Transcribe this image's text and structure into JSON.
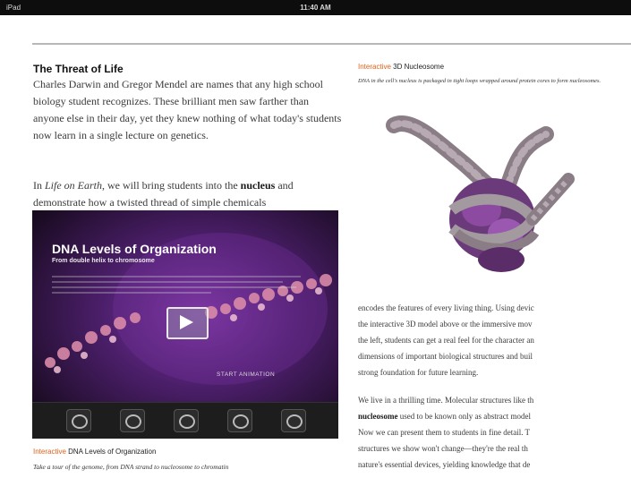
{
  "status_bar": {
    "device": "iPad",
    "time": "11:40 AM"
  },
  "left": {
    "title": "The Threat of Life",
    "para1": "Charles Darwin and Gregor Mendel are names that any high school biology student recognizes. These brilliant men saw farther than anyone else in their day, yet they knew nothing of what today's students now learn in a single lecture on genetics.",
    "para2_before_em": "In ",
    "para2_em": "Life on Earth",
    "para2_middle": ", we will bring students into the ",
    "para2_bold": "nucleus",
    "para2_after": " and demonstrate how a twisted thread of simple chemicals",
    "video": {
      "title": "DNA Levels of Organization",
      "subtitle": "From double helix to chromosome",
      "start_label": "START ANIMATION"
    },
    "caption_tag": "Interactive",
    "caption_text": " DNA Levels of Organization",
    "caption_desc": "Take a tour of the genome, from DNA strand to nucleosome to chromatin"
  },
  "right": {
    "caption_tag": "Interactive",
    "caption_text": " 3D Nucleosome",
    "caption_desc": "DNA in the cell's nucleus is packaged in tight loops wrapped around protein cores to form nucleosomes.",
    "lines_a": [
      "encodes the features of every living thing. Using devic",
      "the interactive 3D model above or the immersive mov",
      "the left, students can get a real feel for the character an",
      "dimensions of important biological structures and buil",
      "strong foundation for future learning."
    ],
    "lines_b_1": "We live in a thrilling time. Molecular structures like th",
    "lines_b_2_bold": "nucleosome",
    "lines_b_2_rest": " used to be known only as abstract model",
    "lines_b_3": "Now we can present them to students in fine detail. T",
    "lines_b_4": "structures we show won't change—they're the real th",
    "lines_b_5": "nature's essential devices, yielding knowledge that de"
  },
  "colors": {
    "accent": "#e2621b",
    "status_bar": "#0d0d0d"
  },
  "icons": [
    "play-icon",
    "chromosome-thumb-icon",
    "nucleosome-thumb-icon",
    "dna-thumb-icon",
    "helix-thumb-icon",
    "chromatin-thumb-icon"
  ]
}
